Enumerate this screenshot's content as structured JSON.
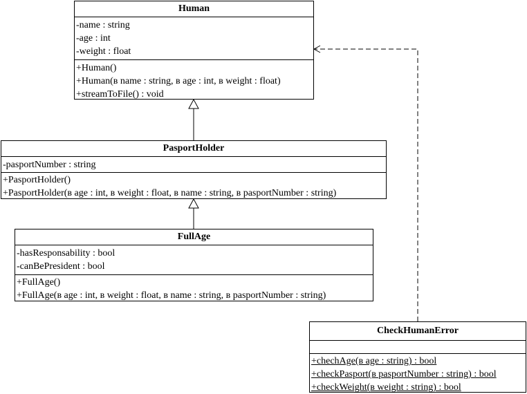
{
  "classes": {
    "human": {
      "name": "Human",
      "attributes": [
        "-name : string",
        "-age : int",
        "-weight : float"
      ],
      "operations": [
        "+Human()",
        "+Human(в name : string, в age : int, в weight : float)",
        "+streamToFile() : void"
      ]
    },
    "pasport_holder": {
      "name": "PasportHolder",
      "attributes": [
        "-pasportNumber : string"
      ],
      "operations": [
        "+PasportHolder()",
        "+PasportHolder(в age : int, в weight : float, в name : string, в pasportNumber : string)"
      ]
    },
    "full_age": {
      "name": "FullAge",
      "attributes": [
        "-hasResponsability : bool",
        "-canBePresident : bool"
      ],
      "operations": [
        "+FullAge()",
        "+FullAge(в age : int, в weight : float, в name : string, в pasportNumber : string)"
      ]
    },
    "check_human_error": {
      "name": "CheckHumanError",
      "attributes": [],
      "operations": [
        "+chechAge(в age : string) : bool",
        "+checkPasport(в pasportNumber : string) : bool",
        "+checkWeight(в weight : string) : bool"
      ]
    }
  },
  "relations": [
    {
      "from": "PasportHolder",
      "to": "Human",
      "kind": "generalization"
    },
    {
      "from": "FullAge",
      "to": "PasportHolder",
      "kind": "generalization"
    },
    {
      "from": "CheckHumanError",
      "to": "Human",
      "kind": "dependency"
    }
  ]
}
